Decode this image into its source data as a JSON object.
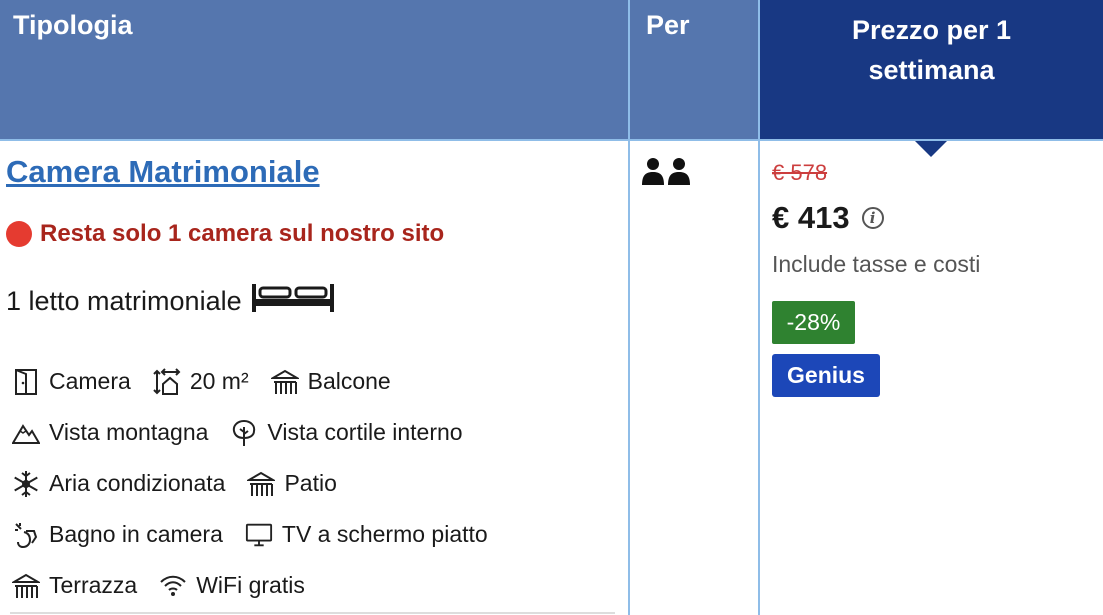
{
  "header": {
    "type_label": "Tipologia",
    "per_label": "Per",
    "price_label": "Prezzo per 1 settimana"
  },
  "room": {
    "name": "Camera Matrimoniale",
    "availability_warning": "Resta solo 1 camera sul nostro sito",
    "bed": "1 letto matrimoniale",
    "occupancy_icon": "two-persons-icon",
    "facilities": [
      {
        "label": "Camera",
        "icon": "door-icon"
      },
      {
        "label": "20 m²",
        "icon": "area-icon"
      },
      {
        "label": "Balcone",
        "icon": "balcony-icon"
      },
      {
        "label": "Vista montagna",
        "icon": "mountain-icon"
      },
      {
        "label": "Vista cortile interno",
        "icon": "tree-icon"
      },
      {
        "label": "Aria condizionata",
        "icon": "snowflake-icon"
      },
      {
        "label": "Patio",
        "icon": "patio-icon"
      },
      {
        "label": "Bagno in camera",
        "icon": "shower-icon"
      },
      {
        "label": "TV a schermo piatto",
        "icon": "tv-icon"
      },
      {
        "label": "Terrazza",
        "icon": "terrace-icon"
      },
      {
        "label": "WiFi gratis",
        "icon": "wifi-icon"
      }
    ]
  },
  "price": {
    "old": "€ 578",
    "current": "€ 413",
    "taxes_note": "Include tasse e costi",
    "discount": "-28%",
    "badge": "Genius"
  },
  "colors": {
    "header_bg": "#5576ae",
    "price_header_bg": "#183883",
    "link": "#2d6bb7",
    "warning": "#a8251c",
    "discount_bg": "#2f8230",
    "genius_bg": "#1c47b8"
  }
}
